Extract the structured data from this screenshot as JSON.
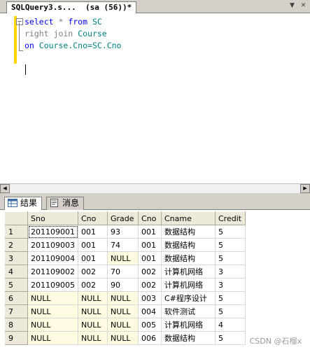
{
  "editor_tab": {
    "title": "SQLQuery3.s...  (sa (56))*"
  },
  "code": {
    "line1": {
      "kw1": "select",
      "sym": " * ",
      "kw2": "from",
      "id": " SC"
    },
    "line2": {
      "kw1": "right join",
      "id": " Course"
    },
    "line3": {
      "kw1": "on",
      "id": " Course.Cno=SC.Cno"
    }
  },
  "results_tabs": [
    {
      "label": "结果"
    },
    {
      "label": "消息"
    }
  ],
  "columns": [
    "Sno",
    "Cno",
    "Grade",
    "Cno",
    "Cname",
    "Credit"
  ],
  "rows": [
    {
      "n": "1",
      "cells": [
        "201109001",
        "001",
        "93",
        "001",
        "数据结构",
        "5"
      ]
    },
    {
      "n": "2",
      "cells": [
        "201109003",
        "001",
        "74",
        "001",
        "数据结构",
        "5"
      ]
    },
    {
      "n": "3",
      "cells": [
        "201109004",
        "001",
        "NULL",
        "001",
        "数据结构",
        "5"
      ]
    },
    {
      "n": "4",
      "cells": [
        "201109002",
        "002",
        "70",
        "002",
        "计算机网络",
        "3"
      ]
    },
    {
      "n": "5",
      "cells": [
        "201109005",
        "002",
        "90",
        "002",
        "计算机网络",
        "3"
      ]
    },
    {
      "n": "6",
      "cells": [
        "NULL",
        "NULL",
        "NULL",
        "003",
        "C#程序设计",
        "5"
      ]
    },
    {
      "n": "7",
      "cells": [
        "NULL",
        "NULL",
        "NULL",
        "004",
        "软件测试",
        "5"
      ]
    },
    {
      "n": "8",
      "cells": [
        "NULL",
        "NULL",
        "NULL",
        "005",
        "计算机网络",
        "4"
      ]
    },
    {
      "n": "9",
      "cells": [
        "NULL",
        "NULL",
        "NULL",
        "006",
        "数据结构",
        "5"
      ]
    }
  ],
  "watermark": "CSDN @石榴x"
}
